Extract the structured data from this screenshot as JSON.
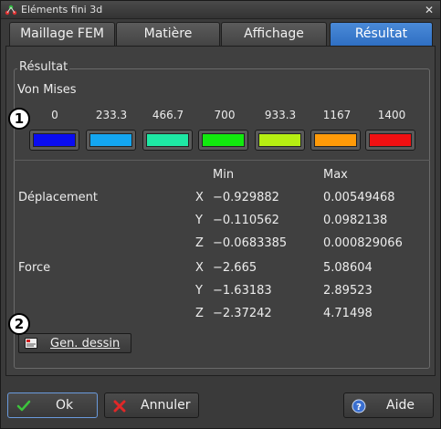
{
  "window": {
    "title": "Eléments fini 3d",
    "close_glyph": "✕"
  },
  "tabs": [
    {
      "label": "Maillage FEM",
      "active": false
    },
    {
      "label": "Matière",
      "active": false
    },
    {
      "label": "Affichage",
      "active": false
    },
    {
      "label": "Résultat",
      "active": true
    }
  ],
  "group": {
    "title": "Résultat"
  },
  "result_type": "Von Mises",
  "scale": [
    {
      "value": "0",
      "color": "#0a0cf2"
    },
    {
      "value": "233.3",
      "color": "#14a6f0"
    },
    {
      "value": "466.7",
      "color": "#1ee8a4"
    },
    {
      "value": "700",
      "color": "#12ea0e"
    },
    {
      "value": "933.3",
      "color": "#b6ee12"
    },
    {
      "value": "1167",
      "color": "#ff9a08"
    },
    {
      "value": "1400",
      "color": "#f21012"
    }
  ],
  "table": {
    "min_header": "Min",
    "max_header": "Max",
    "sections": [
      {
        "label": "Déplacement",
        "rows": [
          {
            "axis": "X",
            "min": "−0.929882",
            "max": "0.00549468"
          },
          {
            "axis": "Y",
            "min": "−0.110562",
            "max": "0.0982138"
          },
          {
            "axis": "Z",
            "min": "−0.0683385",
            "max": "0.000829066"
          }
        ]
      },
      {
        "label": "Force",
        "rows": [
          {
            "axis": "X",
            "min": "−2.665",
            "max": "5.08604"
          },
          {
            "axis": "Y",
            "min": "−1.63183",
            "max": "2.89523"
          },
          {
            "axis": "Z",
            "min": "−2.37242",
            "max": "4.71498"
          }
        ]
      }
    ]
  },
  "badges": [
    "1",
    "2"
  ],
  "gen_button": {
    "label": "Gen. dessin",
    "icon": "drawing-icon"
  },
  "footer": {
    "ok": {
      "label": "Ok",
      "icon": "check-icon"
    },
    "cancel": {
      "label": "Annuler",
      "icon": "cross-icon"
    },
    "help": {
      "label": "Aide",
      "icon": "help-icon"
    }
  }
}
